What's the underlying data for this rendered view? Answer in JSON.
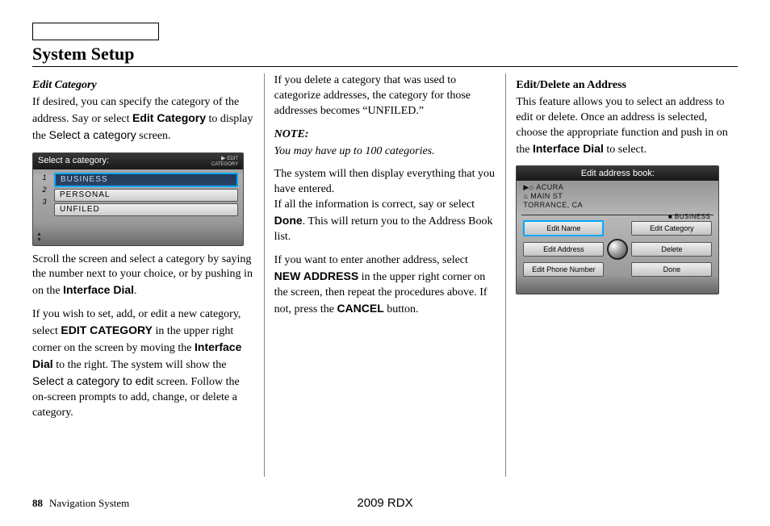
{
  "header": {
    "title": "System Setup"
  },
  "col1": {
    "sub": "Edit Category",
    "p1a": "If desired, you can specify the category of the address. Say or select ",
    "p1b": "Edit Category",
    "p1c": " to display the ",
    "p1d": "Select a category",
    "p1e": " screen.",
    "ss": {
      "title": "Select a category:",
      "edit": "EDIT\nCATEGORY",
      "n1": "1",
      "n2": "2",
      "n3": "3",
      "r1": "BUSINESS",
      "r2": "PERSONAL",
      "r3": "UNFILED",
      "up": "UP",
      "down": "DOWN"
    },
    "p2a": "Scroll the screen and select a category by saying the number next to your choice, or by pushing in on the ",
    "p2b": "Interface Dial",
    "p2c": ".",
    "p3a": "If you wish to set, add, or edit a new category, select ",
    "p3b": "EDIT CATEGORY",
    "p3c": " in the upper right corner on the screen by moving the ",
    "p3d": "Interface Dial",
    "p3e": " to the right. The system will show the ",
    "p3f": "Select a category to edit",
    "p3g": " screen. Follow the on-screen prompts to add, change, or delete a category."
  },
  "col2": {
    "p1": "If you delete a category that was used to categorize addresses, the category for those addresses becomes “UNFILED.”",
    "note": "NOTE:",
    "noteText": "You may have up to 100 categories.",
    "p2a": "The system will then display everything that you have entered.\nIf all the information is correct, say or select ",
    "p2b": "Done",
    "p2c": ". This will return you to the Address Book list.",
    "p3a": "If you want to enter another address, select ",
    "p3b": "NEW ADDRESS",
    "p3c": " in the upper right corner on the screen, then repeat the procedures above. If not, press the ",
    "p3d": "CANCEL",
    "p3e": " button."
  },
  "col3": {
    "sub": "Edit/Delete an Address",
    "p1a": "This feature allows you to select an address to edit or delete. Once an address is selected, choose the appropriate function and push in on the ",
    "p1b": "Interface Dial",
    "p1c": " to select.",
    "ss": {
      "title": "Edit address book:",
      "l1": "▶⌂ ACURA",
      "l2": "⌂ MAIN ST",
      "l3": "   TORRANCE, CA",
      "biz": "■ BUSINESS",
      "b1": "Edit Name",
      "b2": "Edit Category",
      "b3": "Edit Address",
      "b4": "Delete",
      "b5": "Edit Phone Number",
      "b6": "Done"
    }
  },
  "footer": {
    "page": "88",
    "section": "Navigation System",
    "model": "2009 RDX"
  }
}
